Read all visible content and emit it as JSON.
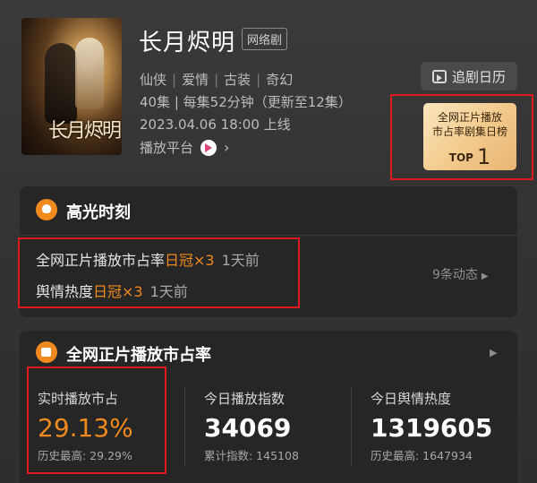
{
  "show": {
    "title": "长月烬明",
    "tag": "网络剧",
    "genres": [
      "仙侠",
      "爱情",
      "古装",
      "奇幻"
    ],
    "episodes": "40集 | 每集52分钟（更新至12集）",
    "air_time": "2023.04.06 18:00 上线",
    "platform_label": "播放平台",
    "poster_text": "长月烬明"
  },
  "actions": {
    "follow_calendar": "追剧日历"
  },
  "rank_badge": {
    "line1": "全网正片播放",
    "line2": "市占率剧集日榜",
    "top_label": "TOP",
    "top_number": "1"
  },
  "highlights": {
    "title": "高光时刻",
    "rows": [
      {
        "text": "全网正片播放市占率",
        "badge": "日冠×3",
        "ago": "1天前"
      },
      {
        "text": "舆情热度",
        "badge": "日冠×3",
        "ago": "1天前"
      }
    ],
    "more": "9条动态",
    "more_arrow": "▶"
  },
  "market_share": {
    "title": "全网正片播放市占率",
    "arrow": "▶",
    "stats": [
      {
        "label": "实时播放市占",
        "value": "29.13%",
        "sub": "历史最高: 29.29%"
      },
      {
        "label": "今日播放指数",
        "value": "34069",
        "sub": "累计指数: 145108"
      },
      {
        "label": "今日舆情热度",
        "value": "1319605",
        "sub": "历史最高: 1647934"
      }
    ]
  },
  "colors": {
    "accent": "#f08a1e",
    "highlight_border": "#e0191f",
    "badge_gold": "#f2c98a"
  }
}
